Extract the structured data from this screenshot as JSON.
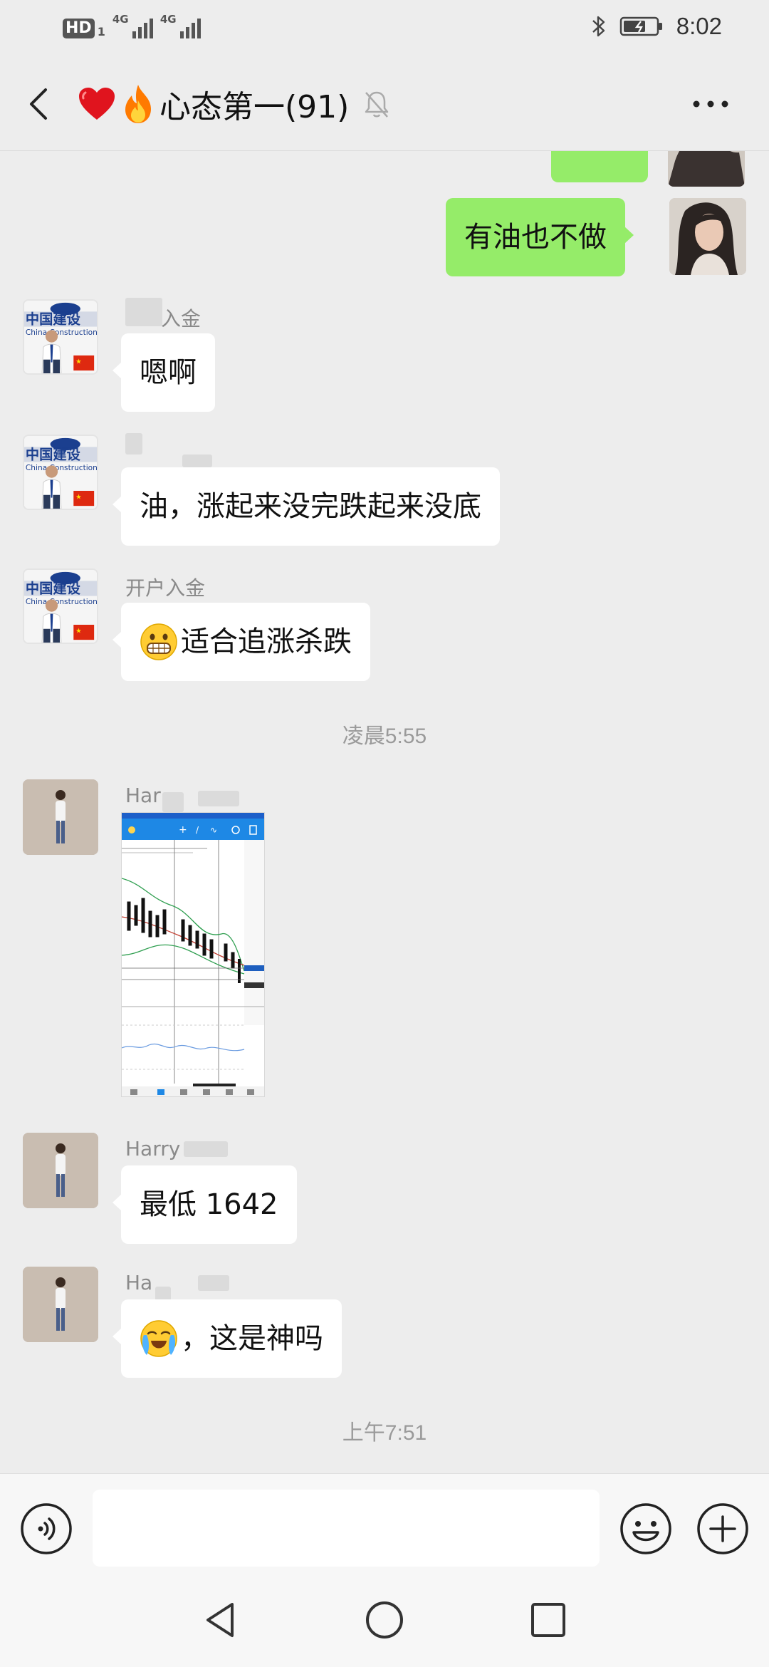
{
  "status_bar": {
    "hd_label": "HD",
    "hd_sub": "1",
    "network_1": "4G",
    "network_2": "4G",
    "time": "8:02",
    "icons": [
      "bluetooth-icon",
      "battery-charging-icon"
    ]
  },
  "header": {
    "title": "心态第一(91)",
    "title_emojis": [
      "red-heart",
      "fire"
    ],
    "back_icon": "chevron-left-icon",
    "mute_icon": "bell-off-icon",
    "more_icon": "more-dots-icon"
  },
  "messages": [
    {
      "id": "m0",
      "direction": "out",
      "type": "text",
      "text": "",
      "partial": true
    },
    {
      "id": "m1",
      "direction": "out",
      "type": "text",
      "text": "有油也不做"
    },
    {
      "id": "m2",
      "direction": "in",
      "sender": "开户入金",
      "sender_partial": "入金",
      "type": "text",
      "text": "嗯啊"
    },
    {
      "id": "m3",
      "direction": "in",
      "sender": "",
      "type": "text",
      "text": "油，涨起来没完跌起来没底"
    },
    {
      "id": "m4",
      "direction": "in",
      "sender": "开户入金",
      "type": "text",
      "emoji": "grimacing-face",
      "text": "适合追涨杀跌"
    },
    {
      "id": "t1",
      "type": "time",
      "text": "凌晨5:55"
    },
    {
      "id": "m5",
      "direction": "in",
      "sender": "Har",
      "type": "image",
      "image_desc": "trading-chart-screenshot"
    },
    {
      "id": "m6",
      "direction": "in",
      "sender": "Harry",
      "type": "text",
      "text": "最低 1642"
    },
    {
      "id": "m7",
      "direction": "in",
      "sender": "Ha",
      "type": "text",
      "emoji": "loudly-crying-face",
      "text": "，这是神吗"
    },
    {
      "id": "t2",
      "type": "time",
      "text": "上午7:51"
    }
  ],
  "input_bar": {
    "placeholder": "",
    "value": "",
    "voice_icon": "voice-icon",
    "emoji_icon": "emoji-face-icon",
    "plus_icon": "plus-circle-icon"
  },
  "nav_bar": {
    "icons": [
      "nav-back-icon",
      "nav-home-icon",
      "nav-recent-icon"
    ]
  },
  "colors": {
    "chat_background": "#ededed",
    "outgoing_bubble": "#95ec69",
    "incoming_bubble": "#ffffff",
    "time_separator": "#9a9a9a",
    "sender_name": "#8a8a8a"
  }
}
